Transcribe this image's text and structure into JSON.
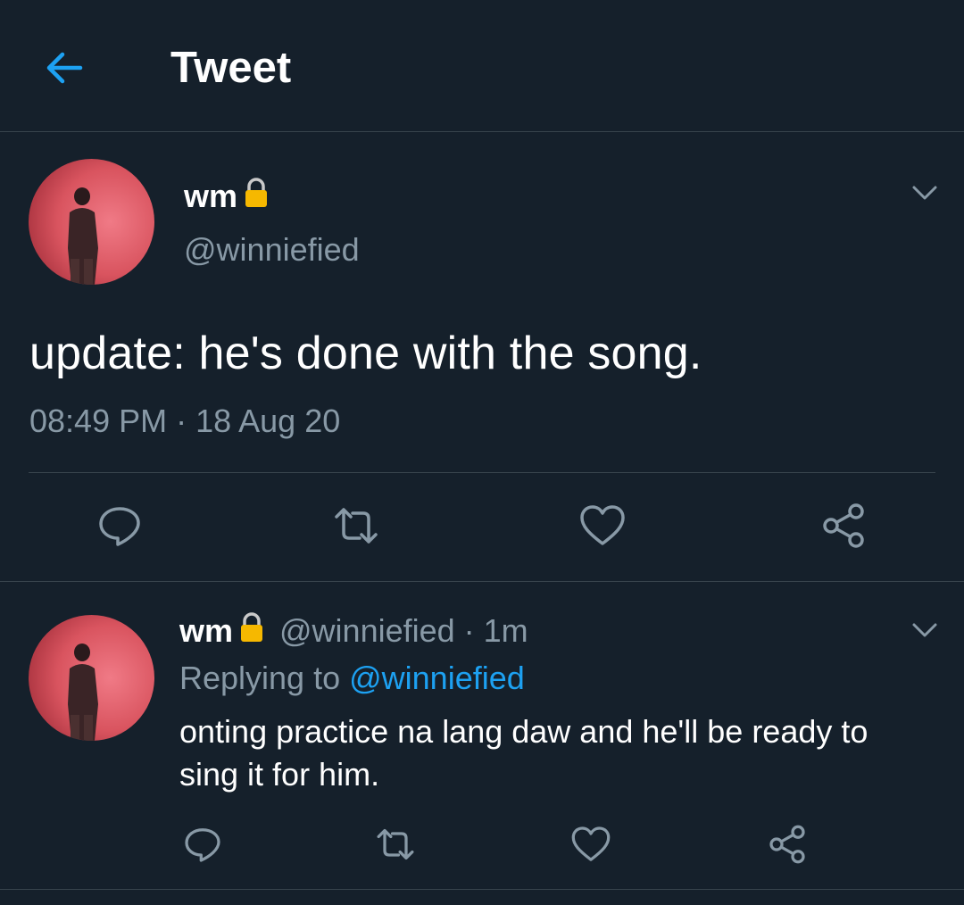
{
  "header": {
    "title": "Tweet",
    "back_icon": "arrow-left-icon"
  },
  "colors": {
    "background": "#15202b",
    "accent": "#1da1f2",
    "muted": "#8899a6",
    "divider": "#38444d",
    "lock": "#f6b800"
  },
  "main_tweet": {
    "display_name": "wm",
    "handle": "@winniefied",
    "text": "update: he's done with the song.",
    "meta": "08:49 PM · 18 Aug 20",
    "actions": [
      "reply-icon",
      "retweet-icon",
      "like-icon",
      "share-icon"
    ]
  },
  "reply_tweet": {
    "display_name": "wm",
    "handle_time": "@winniefied · 1m",
    "replying_prefix": "Replying to ",
    "replying_to": "@winniefied",
    "text": "onting practice na lang daw and he'll be ready to sing it for him.",
    "actions": [
      "reply-icon",
      "retweet-icon",
      "like-icon",
      "share-icon"
    ]
  }
}
